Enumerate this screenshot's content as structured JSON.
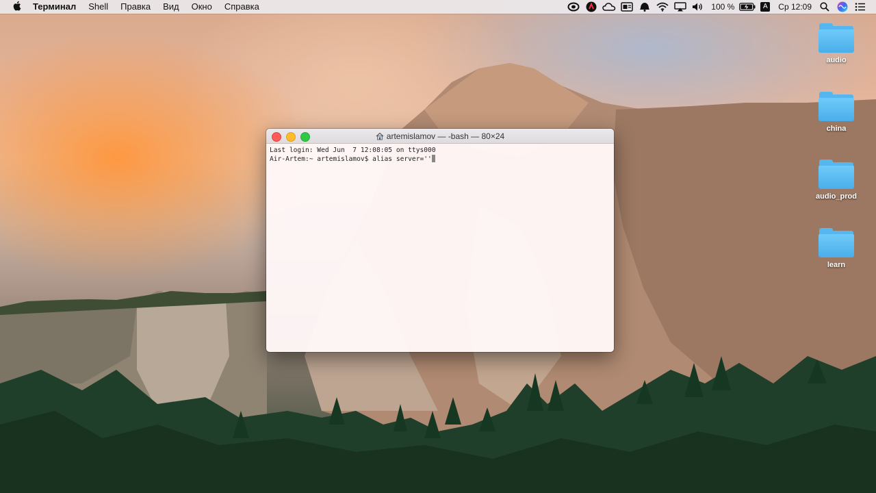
{
  "menubar": {
    "apple": "",
    "app_name": "Терминал",
    "items": [
      "Shell",
      "Правка",
      "Вид",
      "Окно",
      "Справка"
    ],
    "status": {
      "battery": "100 %",
      "input_source": "A",
      "clock": "Ср 12:09"
    },
    "status_icons": [
      "creative-cloud-icon",
      "app-icon",
      "cloud-icon",
      "card-icon",
      "notification-icon",
      "wifi-icon",
      "airplay-icon",
      "volume-icon",
      "battery-icon",
      "input-source-icon",
      "spotlight-icon",
      "siri-icon",
      "list-icon"
    ]
  },
  "desktop": {
    "icons": [
      {
        "label": "audio"
      },
      {
        "label": "china"
      },
      {
        "label": "audio_prod"
      },
      {
        "label": "learn"
      }
    ]
  },
  "terminal": {
    "title": "artemislamov — -bash — 80×24",
    "lines": [
      "Last login: Wed Jun  7 12:08:05 on ttys000",
      "Air-Artem:~ artemislamov$ alias server=''"
    ]
  }
}
